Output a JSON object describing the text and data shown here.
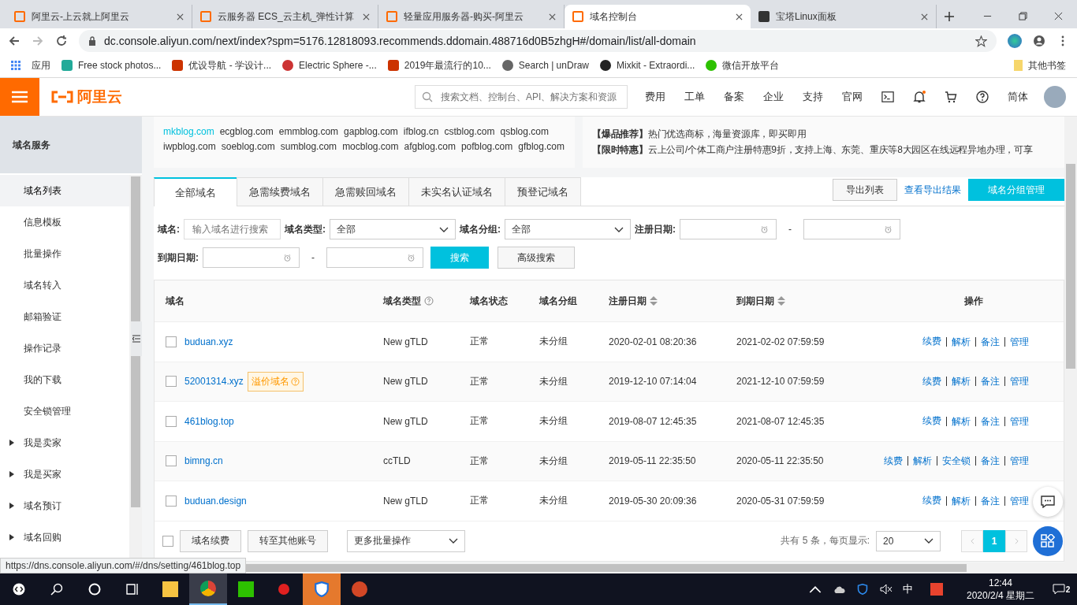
{
  "browser": {
    "tabs": [
      {
        "title": "阿里云-上云就上阿里云",
        "selected": false
      },
      {
        "title": "云服务器 ECS_云主机_弹性计算",
        "selected": false
      },
      {
        "title": "轻量应用服务器-购买-阿里云",
        "selected": false
      },
      {
        "title": "域名控制台",
        "selected": true
      },
      {
        "title": "宝塔Linux面板",
        "selected": false
      }
    ],
    "url": "dc.console.aliyun.com/next/index?spm=5176.12818093.recommends.ddomain.488716d0B5zhgH#/domain/list/all-domain",
    "bookmarks": [
      "应用",
      "Free stock photos...",
      "优设导航 - 学设计...",
      "Electric Sphere -...",
      "2019年最流行的10...",
      "Search | unDraw",
      "Mixkit - Extraordi...",
      "微信开放平台"
    ],
    "other_bookmarks": "其他书签",
    "status_url": "https://dns.console.aliyun.com/#/dns/setting/461blog.top"
  },
  "header": {
    "logo": "阿里云",
    "search_placeholder": "搜索文档、控制台、API、解决方案和资源",
    "nav": [
      "费用",
      "工单",
      "备案",
      "企业",
      "支持",
      "官网"
    ],
    "language": "简体"
  },
  "sidebar": {
    "title": "域名服务",
    "items": [
      {
        "label": "域名列表",
        "kind": "link",
        "selected": true
      },
      {
        "label": "信息模板",
        "kind": "link",
        "selected": false
      },
      {
        "label": "批量操作",
        "kind": "link",
        "selected": false
      },
      {
        "label": "域名转入",
        "kind": "link",
        "selected": false
      },
      {
        "label": "邮箱验证",
        "kind": "link",
        "selected": false
      },
      {
        "label": "操作记录",
        "kind": "link",
        "selected": false
      },
      {
        "label": "我的下载",
        "kind": "link",
        "selected": false
      },
      {
        "label": "安全锁管理",
        "kind": "link",
        "selected": false
      },
      {
        "label": "我是卖家",
        "kind": "group",
        "selected": false
      },
      {
        "label": "我是买家",
        "kind": "group",
        "selected": false
      },
      {
        "label": "域名预订",
        "kind": "group",
        "selected": false
      },
      {
        "label": "域名回购",
        "kind": "group",
        "selected": false
      }
    ]
  },
  "suggestions": [
    {
      "domain": "mkblog.com",
      "selected": true
    },
    {
      "domain": "ecgblog.com",
      "selected": false
    },
    {
      "domain": "emmblog.com",
      "selected": false
    },
    {
      "domain": "gapblog.com",
      "selected": false
    },
    {
      "domain": "ifblog.cn",
      "selected": false
    },
    {
      "domain": "cstblog.com",
      "selected": false
    },
    {
      "domain": "qsblog.com",
      "selected": false
    },
    {
      "domain": "iwpblog.com",
      "selected": false
    },
    {
      "domain": "soeblog.com",
      "selected": false
    },
    {
      "domain": "sumblog.com",
      "selected": false
    },
    {
      "domain": "mocblog.com",
      "selected": false
    },
    {
      "domain": "afgblog.com",
      "selected": false
    },
    {
      "domain": "pofblog.com",
      "selected": false
    },
    {
      "domain": "gfblog.com",
      "selected": false
    }
  ],
  "promos": [
    "**【爆品推荐】**热门优选商标，海量资源库，即买即用",
    "**【限时特惠】**云上公司/个体工商户注册特惠9折，支持上海、东莞、重庆等8大园区在线远程异地办理，可享"
  ],
  "tabs": [
    {
      "label": "全部域名",
      "selected": true
    },
    {
      "label": "急需续费域名",
      "selected": false
    },
    {
      "label": "急需赎回域名",
      "selected": false
    },
    {
      "label": "未实名认证域名",
      "selected": false
    },
    {
      "label": "预登记域名",
      "selected": false
    }
  ],
  "actions": {
    "export": "导出列表",
    "view_export": "查看导出结果",
    "group_manage": "域名分组管理"
  },
  "filters": {
    "domain_label": "域名:",
    "domain_placeholder": "输入域名进行搜索",
    "type_label": "域名类型:",
    "type_value": "全部",
    "group_label": "域名分组:",
    "group_value": "全部",
    "reg_label": "注册日期:",
    "exp_label": "到期日期:",
    "dash": "-",
    "search": "搜索",
    "advanced": "高级搜索"
  },
  "table": {
    "columns": [
      "域名",
      "域名类型",
      "域名状态",
      "域名分组",
      "注册日期",
      "到期日期",
      "操作"
    ],
    "rows": [
      {
        "checked": false,
        "domain": "buduan.xyz",
        "type": "New gTLD",
        "status": "正常",
        "group": "未分组",
        "registered": "2020-02-01 08:20:36",
        "expires": "2021-02-02 07:59:59",
        "ops": [
          "续费",
          "解析",
          "备注",
          "管理"
        ]
      },
      {
        "checked": false,
        "domain": "52001314.xyz",
        "badge": "溢价域名",
        "type": "New gTLD",
        "status": "正常",
        "group": "未分组",
        "registered": "2019-12-10 07:14:04",
        "expires": "2021-12-10 07:59:59",
        "ops": [
          "续费",
          "解析",
          "备注",
          "管理"
        ]
      },
      {
        "checked": false,
        "domain": "461blog.top",
        "type": "New gTLD",
        "status": "正常",
        "group": "未分组",
        "registered": "2019-08-07 12:45:35",
        "expires": "2021-08-07 12:45:35",
        "ops": [
          "续费",
          "解析",
          "备注",
          "管理"
        ]
      },
      {
        "checked": false,
        "domain": "bimng.cn",
        "type": "ccTLD",
        "status": "正常",
        "group": "未分组",
        "registered": "2019-05-11 22:35:50",
        "expires": "2020-05-11 22:35:50",
        "ops": [
          "续费",
          "解析",
          "安全锁",
          "备注",
          "管理"
        ]
      },
      {
        "checked": false,
        "domain": "buduan.design",
        "type": "New gTLD",
        "status": "正常",
        "group": "未分组",
        "registered": "2019-05-30 20:09:36",
        "expires": "2020-05-31 07:59:59",
        "ops": [
          "续费",
          "解析",
          "备注",
          "管理"
        ]
      }
    ]
  },
  "footer": {
    "select_all": false,
    "buttons": [
      "域名续费",
      "转至其他账号"
    ],
    "batch": "更多批量操作",
    "total": "共有 5 条，每页显示:",
    "page_size": "20",
    "pages": [
      {
        "label": "1",
        "selected": true
      }
    ]
  },
  "taskbar": {
    "ime": "中",
    "time": "12:44",
    "date": "2020/2/4 星期二",
    "notifications": "2"
  }
}
